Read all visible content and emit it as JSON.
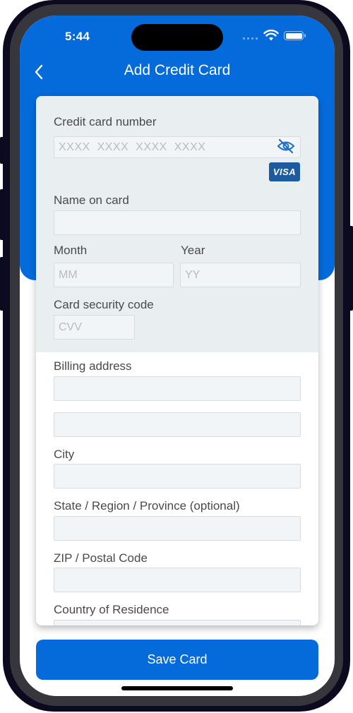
{
  "status_bar": {
    "time": "5:44"
  },
  "nav": {
    "title": "Add Credit Card"
  },
  "form": {
    "card_number": {
      "label": "Credit card number",
      "placeholder": "XXXX  XXXX  XXXX  XXXX",
      "value": ""
    },
    "card_brand": "VISA",
    "name_on_card": {
      "label": "Name on card",
      "value": ""
    },
    "month": {
      "label": "Month",
      "placeholder": "MM",
      "value": ""
    },
    "year": {
      "label": "Year",
      "placeholder": "YY",
      "value": ""
    },
    "security_code": {
      "label": "Card security code",
      "placeholder": "CVV",
      "value": ""
    },
    "billing_address": {
      "label": "Billing address",
      "line1": "",
      "line2": ""
    },
    "city": {
      "label": "City",
      "value": ""
    },
    "state": {
      "label": "State / Region / Province (optional)",
      "value": ""
    },
    "zip": {
      "label": "ZIP / Postal Code",
      "value": ""
    },
    "country": {
      "label": "Country of Residence",
      "value": ""
    }
  },
  "actions": {
    "save_label": "Save Card"
  },
  "colors": {
    "brand_blue": "#056bdb",
    "visa_blue": "#1e5a9e",
    "card_section_bg": "#e9eef1"
  }
}
